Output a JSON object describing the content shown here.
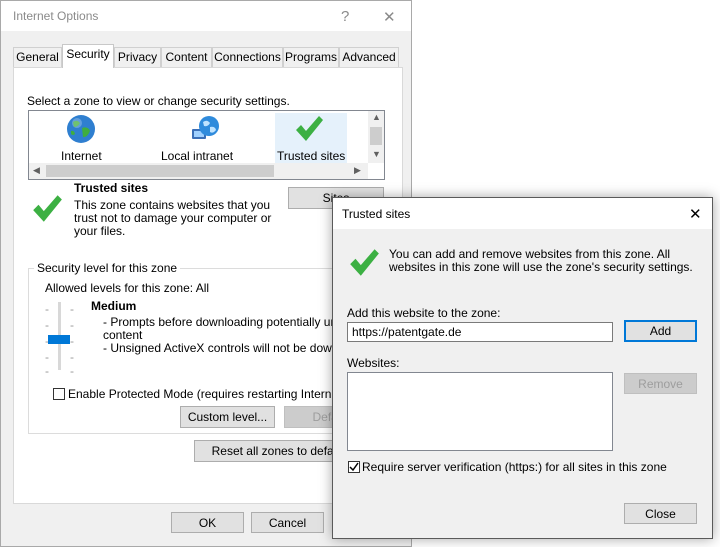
{
  "internet_options": {
    "title": "Internet Options",
    "help_glyph": "?",
    "close_glyph": "✕",
    "tabs": [
      "General",
      "Security",
      "Privacy",
      "Content",
      "Connections",
      "Programs",
      "Advanced"
    ],
    "zone_prompt": "Select a zone to view or change security settings.",
    "zones": [
      "Internet",
      "Local intranet",
      "Trusted sites"
    ],
    "zone_title": "Trusted sites",
    "zone_desc": "This zone contains websites that you trust not to damage your computer or your files.",
    "sites_button": "Sites",
    "security_level_group": "Security level for this zone",
    "allowed_levels": "Allowed levels for this zone: All",
    "level_name": "Medium",
    "level_bullet1": "- Prompts before downloading potentially unsafe",
    "level_bullet1b": "content",
    "level_bullet2": "- Unsigned ActiveX controls will not be download",
    "protected_mode": "Enable Protected Mode (requires restarting Internet Ex",
    "custom_level": "Custom level...",
    "default_level": "Default",
    "reset_all": "Reset all zones to default",
    "ok": "OK",
    "cancel": "Cancel"
  },
  "trusted_sites": {
    "title": "Trusted sites",
    "close_glyph": "✕",
    "info": "You can add and remove websites from this zone. All websites in this zone will use the zone's security settings.",
    "add_label": "Add this website to the zone:",
    "add_value": "https://patentgate.de",
    "add_button": "Add",
    "websites_label": "Websites:",
    "remove_button": "Remove",
    "require_https": "Require server verification (https:) for all sites in this zone",
    "close_button": "Close"
  },
  "colors": {
    "accent": "#0078d7",
    "check_green": "#3cb043"
  }
}
